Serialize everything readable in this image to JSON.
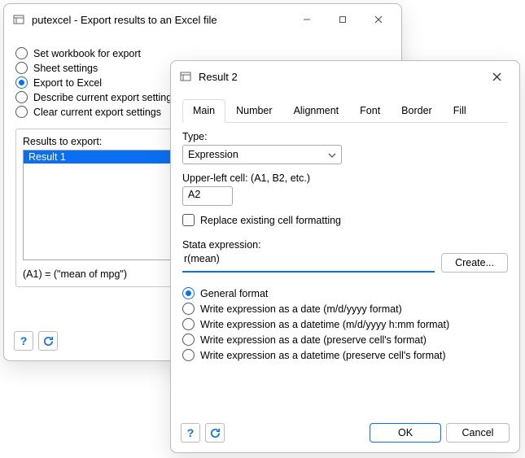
{
  "backWindow": {
    "title": "putexcel - Export results to an Excel file",
    "options": [
      {
        "label": "Set workbook for export",
        "selected": false
      },
      {
        "label": "Sheet settings",
        "selected": false
      },
      {
        "label": "Export to Excel",
        "selected": true
      },
      {
        "label": "Describe current export settings",
        "selected": false
      },
      {
        "label": "Clear current export settings",
        "selected": false
      }
    ],
    "resultsLabel": "Results to export:",
    "listItems": [
      "Result 1"
    ],
    "expressionLine": "(A1) = (\"mean of mpg\")"
  },
  "frontWindow": {
    "title": "Result 2",
    "tabs": [
      "Main",
      "Number",
      "Alignment",
      "Font",
      "Border",
      "Fill"
    ],
    "activeTab": 0,
    "typeLabel": "Type:",
    "typeValue": "Expression",
    "cellLabel": "Upper-left cell: (A1, B2, etc.)",
    "cellValue": "A2",
    "replaceLabel": "Replace existing cell formatting",
    "stataLabel": "Stata expression:",
    "stataValue": "r(mean)",
    "createBtn": "Create...",
    "formats": [
      {
        "label": "General format",
        "selected": true
      },
      {
        "label": "Write expression as a date (m/d/yyyy format)",
        "selected": false
      },
      {
        "label": "Write expression as a datetime (m/d/yyyy h:mm format)",
        "selected": false
      },
      {
        "label": "Write expression as a date (preserve cell's format)",
        "selected": false
      },
      {
        "label": "Write expression as a datetime (preserve cell's format)",
        "selected": false
      }
    ],
    "okBtn": "OK",
    "cancelBtn": "Cancel"
  }
}
